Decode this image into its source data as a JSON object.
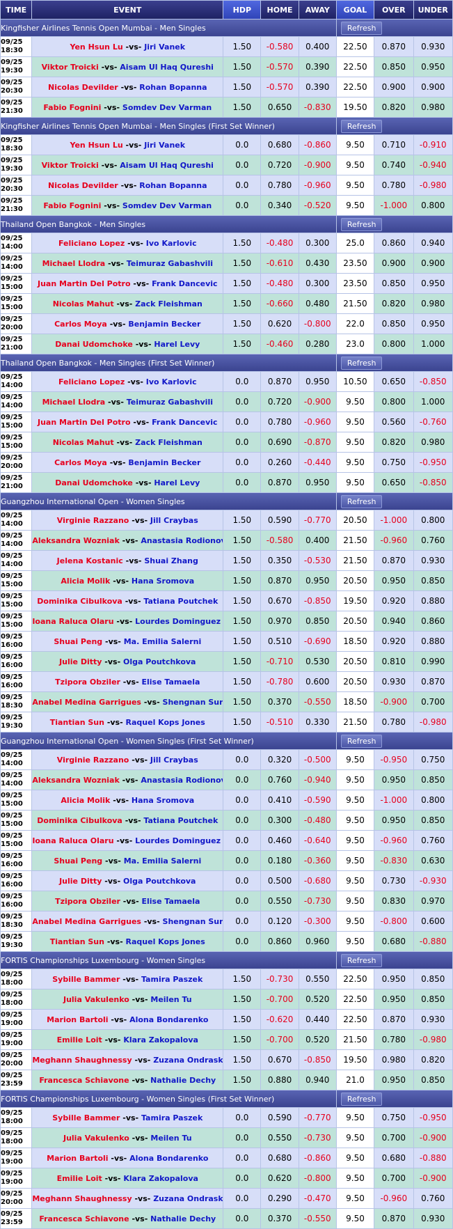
{
  "headers": {
    "time": "TIME",
    "event": "EVENT",
    "hdp": "HDP",
    "home": "HOME",
    "away": "AWAY",
    "goal": "GOAL",
    "over": "OVER",
    "under": "UNDER"
  },
  "refresh_label": "Refresh",
  "vs": "-vs-",
  "sections": [
    {
      "title": "Kingfisher Airlines Tennis Open Mumbai - Men Singles",
      "rows": [
        {
          "date": "09/25",
          "time": "18:30",
          "home": "Yen Hsun Lu",
          "away": "Jiri Vanek",
          "hdp": "1.50",
          "home_odds": "-0.580",
          "away_odds": "0.400",
          "goal": "22.50",
          "over": "0.870",
          "under": "0.930"
        },
        {
          "date": "09/25",
          "time": "19:30",
          "home": "Viktor Troicki",
          "away": "Aisam Ul Haq Qureshi",
          "hdp": "1.50",
          "home_odds": "-0.570",
          "away_odds": "0.390",
          "goal": "22.50",
          "over": "0.850",
          "under": "0.950"
        },
        {
          "date": "09/25",
          "time": "20:30",
          "home": "Nicolas Devilder",
          "away": "Rohan Bopanna",
          "hdp": "1.50",
          "home_odds": "-0.570",
          "away_odds": "0.390",
          "goal": "22.50",
          "over": "0.900",
          "under": "0.900"
        },
        {
          "date": "09/25",
          "time": "21:30",
          "home": "Fabio Fognini",
          "away": "Somdev Dev Varman",
          "hdp": "1.50",
          "home_odds": "0.650",
          "away_odds": "-0.830",
          "goal": "19.50",
          "over": "0.820",
          "under": "0.980"
        }
      ]
    },
    {
      "title": "Kingfisher Airlines Tennis Open Mumbai - Men Singles (First Set Winner)",
      "rows": [
        {
          "date": "09/25",
          "time": "18:30",
          "home": "Yen Hsun Lu",
          "away": "Jiri Vanek",
          "hdp": "0.0",
          "home_odds": "0.680",
          "away_odds": "-0.860",
          "goal": "9.50",
          "over": "0.710",
          "under": "-0.910"
        },
        {
          "date": "09/25",
          "time": "19:30",
          "home": "Viktor Troicki",
          "away": "Aisam Ul Haq Qureshi",
          "hdp": "0.0",
          "home_odds": "0.720",
          "away_odds": "-0.900",
          "goal": "9.50",
          "over": "0.740",
          "under": "-0.940"
        },
        {
          "date": "09/25",
          "time": "20:30",
          "home": "Nicolas Devilder",
          "away": "Rohan Bopanna",
          "hdp": "0.0",
          "home_odds": "0.780",
          "away_odds": "-0.960",
          "goal": "9.50",
          "over": "0.780",
          "under": "-0.980"
        },
        {
          "date": "09/25",
          "time": "21:30",
          "home": "Fabio Fognini",
          "away": "Somdev Dev Varman",
          "hdp": "0.0",
          "home_odds": "0.340",
          "away_odds": "-0.520",
          "goal": "9.50",
          "over": "-1.000",
          "under": "0.800"
        }
      ]
    },
    {
      "title": "Thailand Open Bangkok - Men Singles",
      "rows": [
        {
          "date": "09/25",
          "time": "14:00",
          "home": "Feliciano Lopez",
          "away": "Ivo Karlovic",
          "hdp": "1.50",
          "home_odds": "-0.480",
          "away_odds": "0.300",
          "goal": "25.0",
          "over": "0.860",
          "under": "0.940"
        },
        {
          "date": "09/25",
          "time": "14:00",
          "home": "Michael Llodra",
          "away": "Teimuraz Gabashvili",
          "hdp": "1.50",
          "home_odds": "-0.610",
          "away_odds": "0.430",
          "goal": "23.50",
          "over": "0.900",
          "under": "0.900"
        },
        {
          "date": "09/25",
          "time": "15:00",
          "home": "Juan Martin Del Potro",
          "away": "Frank Dancevic",
          "hdp": "1.50",
          "home_odds": "-0.480",
          "away_odds": "0.300",
          "goal": "23.50",
          "over": "0.850",
          "under": "0.950"
        },
        {
          "date": "09/25",
          "time": "15:00",
          "home": "Nicolas Mahut",
          "away": "Zack Fleishman",
          "hdp": "1.50",
          "home_odds": "-0.660",
          "away_odds": "0.480",
          "goal": "21.50",
          "over": "0.820",
          "under": "0.980"
        },
        {
          "date": "09/25",
          "time": "20:00",
          "home": "Carlos Moya",
          "away": "Benjamin Becker",
          "hdp": "1.50",
          "home_odds": "0.620",
          "away_odds": "-0.800",
          "goal": "22.0",
          "over": "0.850",
          "under": "0.950"
        },
        {
          "date": "09/25",
          "time": "21:00",
          "home": "Danai Udomchoke",
          "away": "Harel Levy",
          "hdp": "1.50",
          "home_odds": "-0.460",
          "away_odds": "0.280",
          "goal": "23.0",
          "over": "0.800",
          "under": "1.000"
        }
      ]
    },
    {
      "title": "Thailand Open Bangkok - Men Singles (First Set Winner)",
      "rows": [
        {
          "date": "09/25",
          "time": "14:00",
          "home": "Feliciano Lopez",
          "away": "Ivo Karlovic",
          "hdp": "0.0",
          "home_odds": "0.870",
          "away_odds": "0.950",
          "goal": "10.50",
          "over": "0.650",
          "under": "-0.850"
        },
        {
          "date": "09/25",
          "time": "14:00",
          "home": "Michael Llodra",
          "away": "Teimuraz Gabashvili",
          "hdp": "0.0",
          "home_odds": "0.720",
          "away_odds": "-0.900",
          "goal": "9.50",
          "over": "0.800",
          "under": "1.000"
        },
        {
          "date": "09/25",
          "time": "15:00",
          "home": "Juan Martin Del Potro",
          "away": "Frank Dancevic",
          "hdp": "0.0",
          "home_odds": "0.780",
          "away_odds": "-0.960",
          "goal": "9.50",
          "over": "0.560",
          "under": "-0.760"
        },
        {
          "date": "09/25",
          "time": "15:00",
          "home": "Nicolas Mahut",
          "away": "Zack Fleishman",
          "hdp": "0.0",
          "home_odds": "0.690",
          "away_odds": "-0.870",
          "goal": "9.50",
          "over": "0.820",
          "under": "0.980"
        },
        {
          "date": "09/25",
          "time": "20:00",
          "home": "Carlos Moya",
          "away": "Benjamin Becker",
          "hdp": "0.0",
          "home_odds": "0.260",
          "away_odds": "-0.440",
          "goal": "9.50",
          "over": "0.750",
          "under": "-0.950"
        },
        {
          "date": "09/25",
          "time": "21:00",
          "home": "Danai Udomchoke",
          "away": "Harel Levy",
          "hdp": "0.0",
          "home_odds": "0.870",
          "away_odds": "0.950",
          "goal": "9.50",
          "over": "0.650",
          "under": "-0.850"
        }
      ]
    },
    {
      "title": "Guangzhou International Open - Women Singles",
      "rows": [
        {
          "date": "09/25",
          "time": "14:00",
          "home": "Virginie Razzano",
          "away": "Jill Craybas",
          "hdp": "1.50",
          "home_odds": "0.590",
          "away_odds": "-0.770",
          "goal": "20.50",
          "over": "-1.000",
          "under": "0.800"
        },
        {
          "date": "09/25",
          "time": "14:00",
          "home": "Aleksandra Wozniak",
          "away": "Anastasia Rodionova",
          "hdp": "1.50",
          "home_odds": "-0.580",
          "away_odds": "0.400",
          "goal": "21.50",
          "over": "-0.960",
          "under": "0.760"
        },
        {
          "date": "09/25",
          "time": "14:00",
          "home": "Jelena Kostanic",
          "away": "Shuai Zhang",
          "hdp": "1.50",
          "home_odds": "0.350",
          "away_odds": "-0.530",
          "goal": "21.50",
          "over": "0.870",
          "under": "0.930"
        },
        {
          "date": "09/25",
          "time": "15:00",
          "home": "Alicia Molik",
          "away": "Hana Sromova",
          "hdp": "1.50",
          "home_odds": "0.870",
          "away_odds": "0.950",
          "goal": "20.50",
          "over": "0.950",
          "under": "0.850"
        },
        {
          "date": "09/25",
          "time": "15:00",
          "home": "Dominika Cibulkova",
          "away": "Tatiana Poutchek",
          "hdp": "1.50",
          "home_odds": "0.670",
          "away_odds": "-0.850",
          "goal": "19.50",
          "over": "0.920",
          "under": "0.880"
        },
        {
          "date": "09/25",
          "time": "15:00",
          "home": "Ioana Raluca Olaru",
          "away": "Lourdes Dominguez Lino",
          "hdp": "1.50",
          "home_odds": "0.970",
          "away_odds": "0.850",
          "goal": "20.50",
          "over": "0.940",
          "under": "0.860"
        },
        {
          "date": "09/25",
          "time": "16:00",
          "home": "Shuai Peng",
          "away": "Ma. Emilia Salerni",
          "hdp": "1.50",
          "home_odds": "0.510",
          "away_odds": "-0.690",
          "goal": "18.50",
          "over": "0.920",
          "under": "0.880"
        },
        {
          "date": "09/25",
          "time": "16:00",
          "home": "Julie Ditty",
          "away": "Olga Poutchkova",
          "hdp": "1.50",
          "home_odds": "-0.710",
          "away_odds": "0.530",
          "goal": "20.50",
          "over": "0.810",
          "under": "0.990"
        },
        {
          "date": "09/25",
          "time": "16:00",
          "home": "Tzipora Obziler",
          "away": "Elise Tamaela",
          "hdp": "1.50",
          "home_odds": "-0.780",
          "away_odds": "0.600",
          "goal": "20.50",
          "over": "0.930",
          "under": "0.870"
        },
        {
          "date": "09/25",
          "time": "18:30",
          "home": "Anabel Medina Garrigues",
          "away": "Shengnan Sun",
          "hdp": "1.50",
          "home_odds": "0.370",
          "away_odds": "-0.550",
          "goal": "18.50",
          "over": "-0.900",
          "under": "0.700"
        },
        {
          "date": "09/25",
          "time": "19:30",
          "home": "Tiantian Sun",
          "away": "Raquel Kops Jones",
          "hdp": "1.50",
          "home_odds": "-0.510",
          "away_odds": "0.330",
          "goal": "21.50",
          "over": "0.780",
          "under": "-0.980"
        }
      ]
    },
    {
      "title": "Guangzhou International Open - Women Singles (First Set Winner)",
      "rows": [
        {
          "date": "09/25",
          "time": "14:00",
          "home": "Virginie Razzano",
          "away": "Jill Craybas",
          "hdp": "0.0",
          "home_odds": "0.320",
          "away_odds": "-0.500",
          "goal": "9.50",
          "over": "-0.950",
          "under": "0.750"
        },
        {
          "date": "09/25",
          "time": "14:00",
          "home": "Aleksandra Wozniak",
          "away": "Anastasia Rodionova",
          "hdp": "0.0",
          "home_odds": "0.760",
          "away_odds": "-0.940",
          "goal": "9.50",
          "over": "0.950",
          "under": "0.850"
        },
        {
          "date": "09/25",
          "time": "15:00",
          "home": "Alicia Molik",
          "away": "Hana Sromova",
          "hdp": "0.0",
          "home_odds": "0.410",
          "away_odds": "-0.590",
          "goal": "9.50",
          "over": "-1.000",
          "under": "0.800"
        },
        {
          "date": "09/25",
          "time": "15:00",
          "home": "Dominika Cibulkova",
          "away": "Tatiana Poutchek",
          "hdp": "0.0",
          "home_odds": "0.300",
          "away_odds": "-0.480",
          "goal": "9.50",
          "over": "0.950",
          "under": "0.850"
        },
        {
          "date": "09/25",
          "time": "15:00",
          "home": "Ioana Raluca Olaru",
          "away": "Lourdes Dominguez Lino",
          "hdp": "0.0",
          "home_odds": "0.460",
          "away_odds": "-0.640",
          "goal": "9.50",
          "over": "-0.960",
          "under": "0.760"
        },
        {
          "date": "09/25",
          "time": "16:00",
          "home": "Shuai Peng",
          "away": "Ma. Emilia Salerni",
          "hdp": "0.0",
          "home_odds": "0.180",
          "away_odds": "-0.360",
          "goal": "9.50",
          "over": "-0.830",
          "under": "0.630"
        },
        {
          "date": "09/25",
          "time": "16:00",
          "home": "Julie Ditty",
          "away": "Olga Poutchkova",
          "hdp": "0.0",
          "home_odds": "0.500",
          "away_odds": "-0.680",
          "goal": "9.50",
          "over": "0.730",
          "under": "-0.930"
        },
        {
          "date": "09/25",
          "time": "16:00",
          "home": "Tzipora Obziler",
          "away": "Elise Tamaela",
          "hdp": "0.0",
          "home_odds": "0.550",
          "away_odds": "-0.730",
          "goal": "9.50",
          "over": "0.830",
          "under": "0.970"
        },
        {
          "date": "09/25",
          "time": "18:30",
          "home": "Anabel Medina Garrigues",
          "away": "Shengnan Sun",
          "hdp": "0.0",
          "home_odds": "0.120",
          "away_odds": "-0.300",
          "goal": "9.50",
          "over": "-0.800",
          "under": "0.600"
        },
        {
          "date": "09/25",
          "time": "19:30",
          "home": "Tiantian Sun",
          "away": "Raquel Kops Jones",
          "hdp": "0.0",
          "home_odds": "0.860",
          "away_odds": "0.960",
          "goal": "9.50",
          "over": "0.680",
          "under": "-0.880"
        }
      ]
    },
    {
      "title": "FORTIS Championships Luxembourg - Women Singles",
      "rows": [
        {
          "date": "09/25",
          "time": "18:00",
          "home": "Sybille Bammer",
          "away": "Tamira Paszek",
          "hdp": "1.50",
          "home_odds": "-0.730",
          "away_odds": "0.550",
          "goal": "22.50",
          "over": "0.950",
          "under": "0.850"
        },
        {
          "date": "09/25",
          "time": "18:00",
          "home": "Julia Vakulenko",
          "away": "Meilen Tu",
          "hdp": "1.50",
          "home_odds": "-0.700",
          "away_odds": "0.520",
          "goal": "22.50",
          "over": "0.950",
          "under": "0.850"
        },
        {
          "date": "09/25",
          "time": "19:00",
          "home": "Marion Bartoli",
          "away": "Alona Bondarenko",
          "hdp": "1.50",
          "home_odds": "-0.620",
          "away_odds": "0.440",
          "goal": "22.50",
          "over": "0.870",
          "under": "0.930"
        },
        {
          "date": "09/25",
          "time": "19:00",
          "home": "Emilie Loit",
          "away": "Klara Zakopalova",
          "hdp": "1.50",
          "home_odds": "-0.700",
          "away_odds": "0.520",
          "goal": "21.50",
          "over": "0.780",
          "under": "-0.980"
        },
        {
          "date": "09/25",
          "time": "20:00",
          "home": "Meghann Shaughnessy",
          "away": "Zuzana Ondraskova",
          "hdp": "1.50",
          "home_odds": "0.670",
          "away_odds": "-0.850",
          "goal": "19.50",
          "over": "0.980",
          "under": "0.820"
        },
        {
          "date": "09/25",
          "time": "23:59",
          "home": "Francesca Schiavone",
          "away": "Nathalie Dechy",
          "hdp": "1.50",
          "home_odds": "0.880",
          "away_odds": "0.940",
          "goal": "21.0",
          "over": "0.950",
          "under": "0.850"
        }
      ]
    },
    {
      "title": "FORTIS Championships Luxembourg - Women Singles (First Set Winner)",
      "rows": [
        {
          "date": "09/25",
          "time": "18:00",
          "home": "Sybille Bammer",
          "away": "Tamira Paszek",
          "hdp": "0.0",
          "home_odds": "0.590",
          "away_odds": "-0.770",
          "goal": "9.50",
          "over": "0.750",
          "under": "-0.950"
        },
        {
          "date": "09/25",
          "time": "18:00",
          "home": "Julia Vakulenko",
          "away": "Meilen Tu",
          "hdp": "0.0",
          "home_odds": "0.550",
          "away_odds": "-0.730",
          "goal": "9.50",
          "over": "0.700",
          "under": "-0.900"
        },
        {
          "date": "09/25",
          "time": "19:00",
          "home": "Marion Bartoli",
          "away": "Alona Bondarenko",
          "hdp": "0.0",
          "home_odds": "0.680",
          "away_odds": "-0.860",
          "goal": "9.50",
          "over": "0.680",
          "under": "-0.880"
        },
        {
          "date": "09/25",
          "time": "19:00",
          "home": "Emilie Loit",
          "away": "Klara Zakopalova",
          "hdp": "0.0",
          "home_odds": "0.620",
          "away_odds": "-0.800",
          "goal": "9.50",
          "over": "0.700",
          "under": "-0.900"
        },
        {
          "date": "09/25",
          "time": "20:00",
          "home": "Meghann Shaughnessy",
          "away": "Zuzana Ondraskova",
          "hdp": "0.0",
          "home_odds": "0.290",
          "away_odds": "-0.470",
          "goal": "9.50",
          "over": "-0.960",
          "under": "0.760"
        },
        {
          "date": "09/25",
          "time": "23:59",
          "home": "Francesca Schiavone",
          "away": "Nathalie Dechy",
          "hdp": "0.0",
          "home_odds": "0.370",
          "away_odds": "-0.550",
          "goal": "9.50",
          "over": "0.870",
          "under": "0.930"
        }
      ]
    }
  ]
}
